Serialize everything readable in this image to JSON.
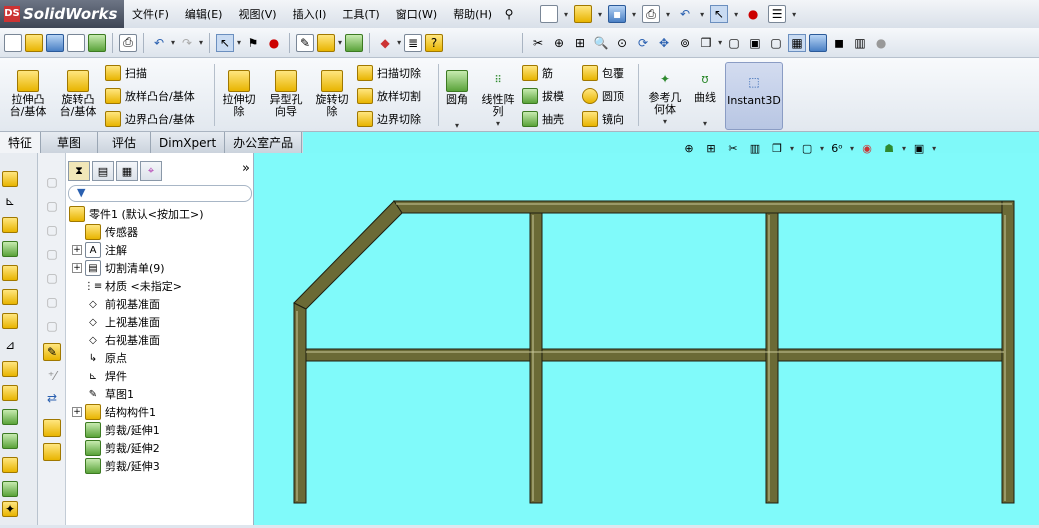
{
  "app": {
    "name": "SolidWorks",
    "logo_mark": "DS"
  },
  "menu": [
    "文件(F)",
    "编辑(E)",
    "视图(V)",
    "插入(I)",
    "工具(T)",
    "窗口(W)",
    "帮助(H)"
  ],
  "command_manager": {
    "big_buttons": [
      {
        "label": "拉伸凸\n台/基体",
        "icon": "extrude-boss-icon"
      },
      {
        "label": "旋转凸\n台/基体",
        "icon": "revolve-boss-icon"
      },
      {
        "label": "拉伸切\n除",
        "icon": "extrude-cut-icon"
      },
      {
        "label": "异型孔\n向导",
        "icon": "hole-wizard-icon"
      },
      {
        "label": "旋转切\n除",
        "icon": "revolve-cut-icon"
      },
      {
        "label": "圆角",
        "icon": "fillet-icon"
      },
      {
        "label": "线性阵\n列",
        "icon": "linear-pattern-icon"
      },
      {
        "label": "参考几\n何体",
        "icon": "reference-geometry-icon"
      },
      {
        "label": "曲线",
        "icon": "curves-icon"
      },
      {
        "label": "Instant3D",
        "icon": "instant3d-icon"
      }
    ],
    "small_group1": [
      "扫描",
      "放样凸台/基体",
      "边界凸台/基体"
    ],
    "small_group2": [
      "扫描切除",
      "放样切割",
      "边界切除"
    ],
    "small_group3": [
      "筋",
      "拔模",
      "抽壳"
    ],
    "small_group4": [
      "包覆",
      "圆顶",
      "镜向"
    ]
  },
  "tabs": [
    "特征",
    "草图",
    "评估",
    "DimXpert",
    "办公室产品"
  ],
  "active_tab": "特征",
  "tree": {
    "root": "零件1  (默认<按加工>)",
    "items": [
      {
        "label": "传感器",
        "icon": "sensor-icon",
        "expandable": false
      },
      {
        "label": "注解",
        "icon": "annotation-icon",
        "expandable": true
      },
      {
        "label": "切割清单(9)",
        "icon": "cut-list-icon",
        "expandable": true
      },
      {
        "label": "材质 <未指定>",
        "icon": "material-icon",
        "expandable": false
      },
      {
        "label": "前视基准面",
        "icon": "plane-icon",
        "expandable": false
      },
      {
        "label": "上视基准面",
        "icon": "plane-icon",
        "expandable": false
      },
      {
        "label": "右视基准面",
        "icon": "plane-icon",
        "expandable": false
      },
      {
        "label": "原点",
        "icon": "origin-icon",
        "expandable": false
      },
      {
        "label": "焊件",
        "icon": "weldment-icon",
        "expandable": false
      },
      {
        "label": "草图1",
        "icon": "sketch-icon",
        "expandable": false
      },
      {
        "label": "结构构件1",
        "icon": "structural-member-icon",
        "expandable": true
      },
      {
        "label": "剪裁/延伸1",
        "icon": "trim-extend-icon",
        "expandable": false
      },
      {
        "label": "剪裁/延伸2",
        "icon": "trim-extend-icon",
        "expandable": false
      },
      {
        "label": "剪裁/延伸3",
        "icon": "trim-extend-icon",
        "expandable": false
      }
    ]
  },
  "colors": {
    "viewport": "#80fafa",
    "frame": "#6b6a36",
    "frame_edge": "#2a2a14"
  }
}
